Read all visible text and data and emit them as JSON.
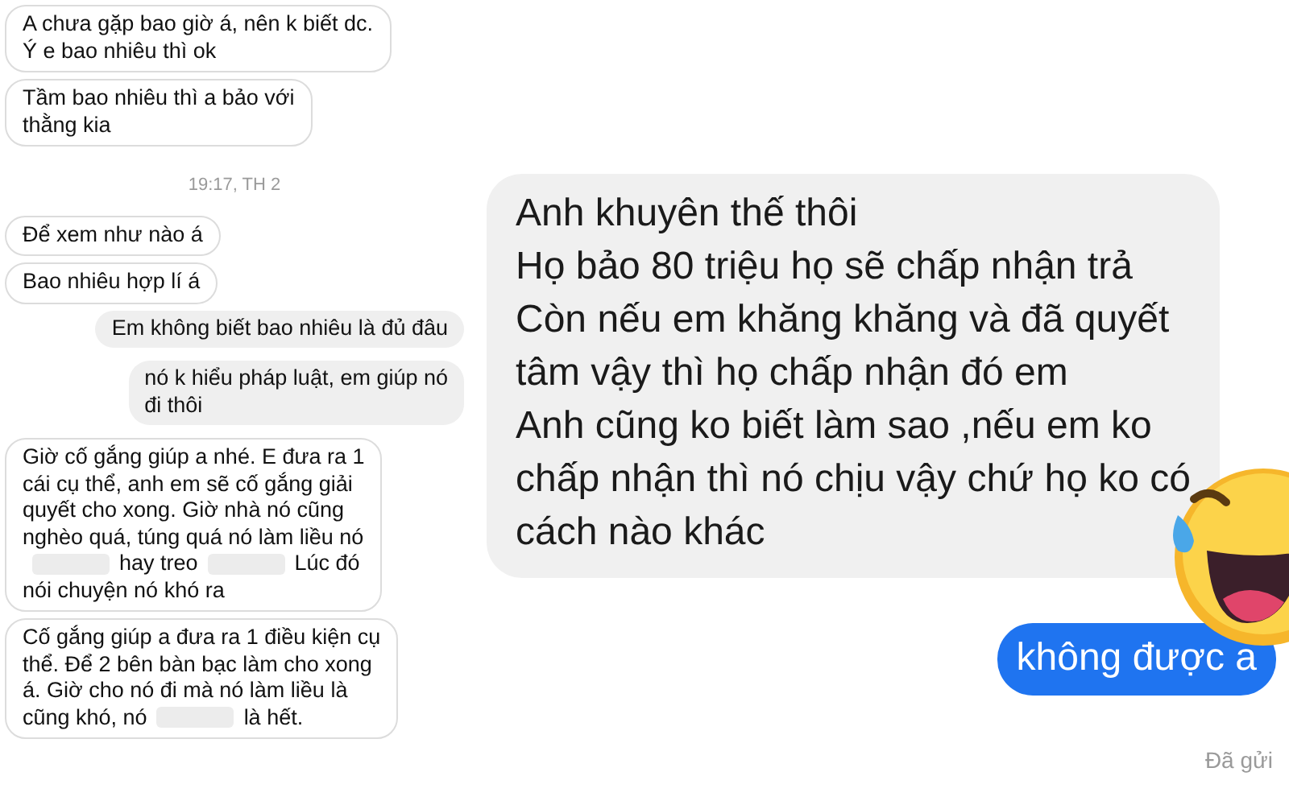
{
  "left_messages": [
    {
      "kind": "received",
      "lines": [
        "A chưa gặp bao giờ á, nên k biết dc.",
        "Ý e bao nhiêu thì ok"
      ]
    },
    {
      "kind": "received",
      "lines": [
        "Tầm bao nhiêu thì a bảo với",
        "thằng kia"
      ]
    },
    {
      "kind": "time",
      "lines": [
        "19:17, TH 2"
      ]
    },
    {
      "kind": "received",
      "lines": [
        "Để xem như nào á"
      ]
    },
    {
      "kind": "received",
      "lines": [
        "Bao nhiêu hợp lí á"
      ]
    },
    {
      "kind": "sent",
      "lines": [
        "Em không biết bao nhiêu là đủ đâu"
      ]
    },
    {
      "kind": "sent",
      "lines": [
        "nó k hiểu pháp luật, em giúp nó",
        "đi thôi"
      ]
    },
    {
      "kind": "received",
      "lines": [
        "Giờ cố gắng giúp a nhé. E đưa ra 1",
        "cái cụ thể, anh em sẽ cố gắng giải",
        "quyết cho xong. Giờ nhà nó cũng",
        "nghèo quá, túng quá nó làm liều nó",
        [
          {
            "kind": "redacted"
          },
          "hay treo",
          {
            "kind": "redacted"
          },
          "Lúc đó"
        ],
        "nói chuyện nó khó ra"
      ]
    },
    {
      "kind": "received",
      "lines": [
        "Cố gắng giúp a đưa ra 1 điều kiện cụ",
        "thể. Để 2 bên bàn bạc làm cho xong",
        "á. Giờ cho nó đi mà nó làm liều là",
        [
          "cũng khó, nó",
          {
            "kind": "redacted"
          },
          "là hết."
        ]
      ]
    }
  ],
  "right_messages": [
    {
      "kind": "received_large",
      "paragraphs": [
        "Anh khuyên thế thôi",
        "Họ bảo 80 triệu họ sẽ chấp nhận trả",
        "Còn nếu em khăng khăng và đã quyết tâm vậy thì họ chấp nhận đó em",
        "Anh cũng ko biết làm sao ,nếu em ko chấp nhận thì nó chịu vậy chứ họ ko có cách nào khác"
      ]
    },
    {
      "kind": "sent_large",
      "paragraphs": [
        "không được a"
      ]
    }
  ],
  "status": "Đã gửi"
}
